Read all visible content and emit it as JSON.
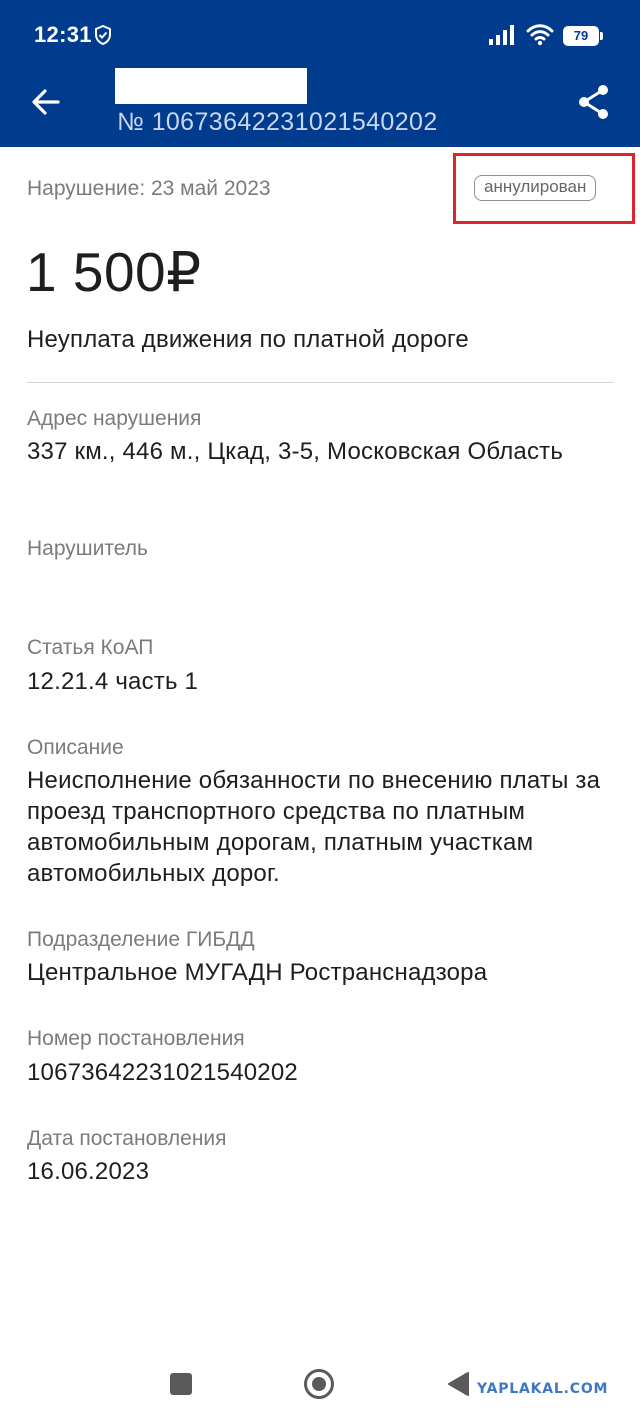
{
  "status_bar": {
    "time": "12:31",
    "battery": "79"
  },
  "header": {
    "number": "№ 10673642231021540202"
  },
  "summary": {
    "date": "Нарушение: 23 май 2023",
    "status_badge": "аннулирован",
    "amount": "1 500₽",
    "title": "Неуплата движения по платной дороге"
  },
  "details": {
    "address_label": "Адрес нарушения",
    "address_value": "337 км., 446 м., Цкад, 3-5, Московская Область",
    "violator_label": "Нарушитель",
    "article_label": "Статья КоАП",
    "article_value": "12.21.4 часть 1",
    "description_label": "Описание",
    "description_value": "Неисполнение обязанности по внесению платы за проезд транспортного средства по платным автомобильным дорогам, платным участкам автомобильных дорог.",
    "division_label": "Подразделение ГИБДД",
    "division_value": "Центральное МУГАДН Ространснадзора",
    "resolution_number_label": "Номер постановления",
    "resolution_number_value": "10673642231021540202",
    "resolution_date_label": "Дата постановления",
    "resolution_date_value": "16.06.2023"
  },
  "watermark": "YAPLAKAL.COM",
  "colors": {
    "header_bg": "#003b8e",
    "highlight": "#e0242c",
    "watermark": "#3d77c6"
  },
  "icons": {
    "back": "arrow-left-icon",
    "share": "share-icon",
    "shield": "shield-check-icon",
    "signal": "cellular-signal-icon",
    "wifi": "wifi-icon"
  }
}
